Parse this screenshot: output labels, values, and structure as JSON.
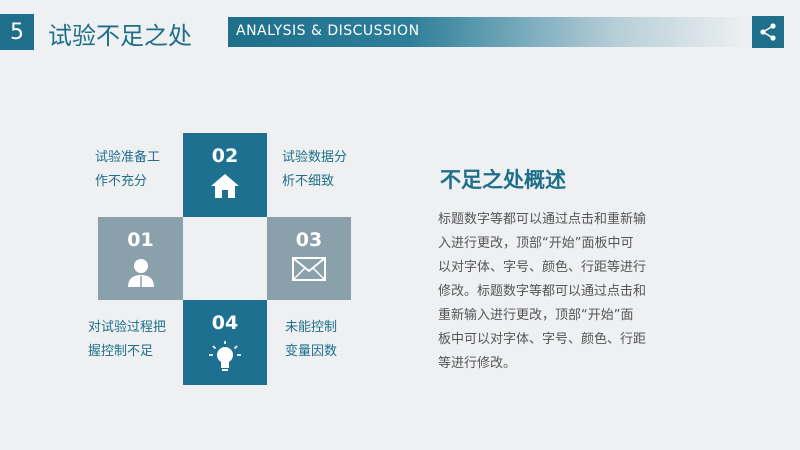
{
  "header": {
    "section_number": "5",
    "title": "试验不足之处",
    "banner_text": "ANALYSIS & DISCUSSION"
  },
  "tiles": [
    {
      "num": "02",
      "icon": "home-icon"
    },
    {
      "num": "01",
      "icon": "person-icon"
    },
    {
      "num": "03",
      "icon": "mail-icon"
    },
    {
      "num": "04",
      "icon": "lightbulb-icon"
    }
  ],
  "labels": {
    "tl": [
      "试验准备工",
      "作不充分"
    ],
    "tr": [
      "试验数据分",
      "析不细致"
    ],
    "bl": [
      "对试验过程把",
      "握控制不足"
    ],
    "br": [
      "未能控制",
      "变量因数"
    ]
  },
  "summary": {
    "title": "不足之处概述",
    "lines": [
      "标题数字等都可以通过点击和重新输",
      "入进行更改，顶部“开始”面板中可",
      "以对字体、字号、颜色、行距等进行",
      "修改。标题数字等都可以通过点击和",
      "重新输入进行更改，顶部“开始”面",
      "板中可以对字体、字号、颜色、行距",
      "等进行修改。"
    ]
  },
  "colors": {
    "accent": "#1f6f8b",
    "tile_dark": "#1e7090",
    "tile_grey": "#8aa0ab",
    "background": "#eef0f2"
  }
}
